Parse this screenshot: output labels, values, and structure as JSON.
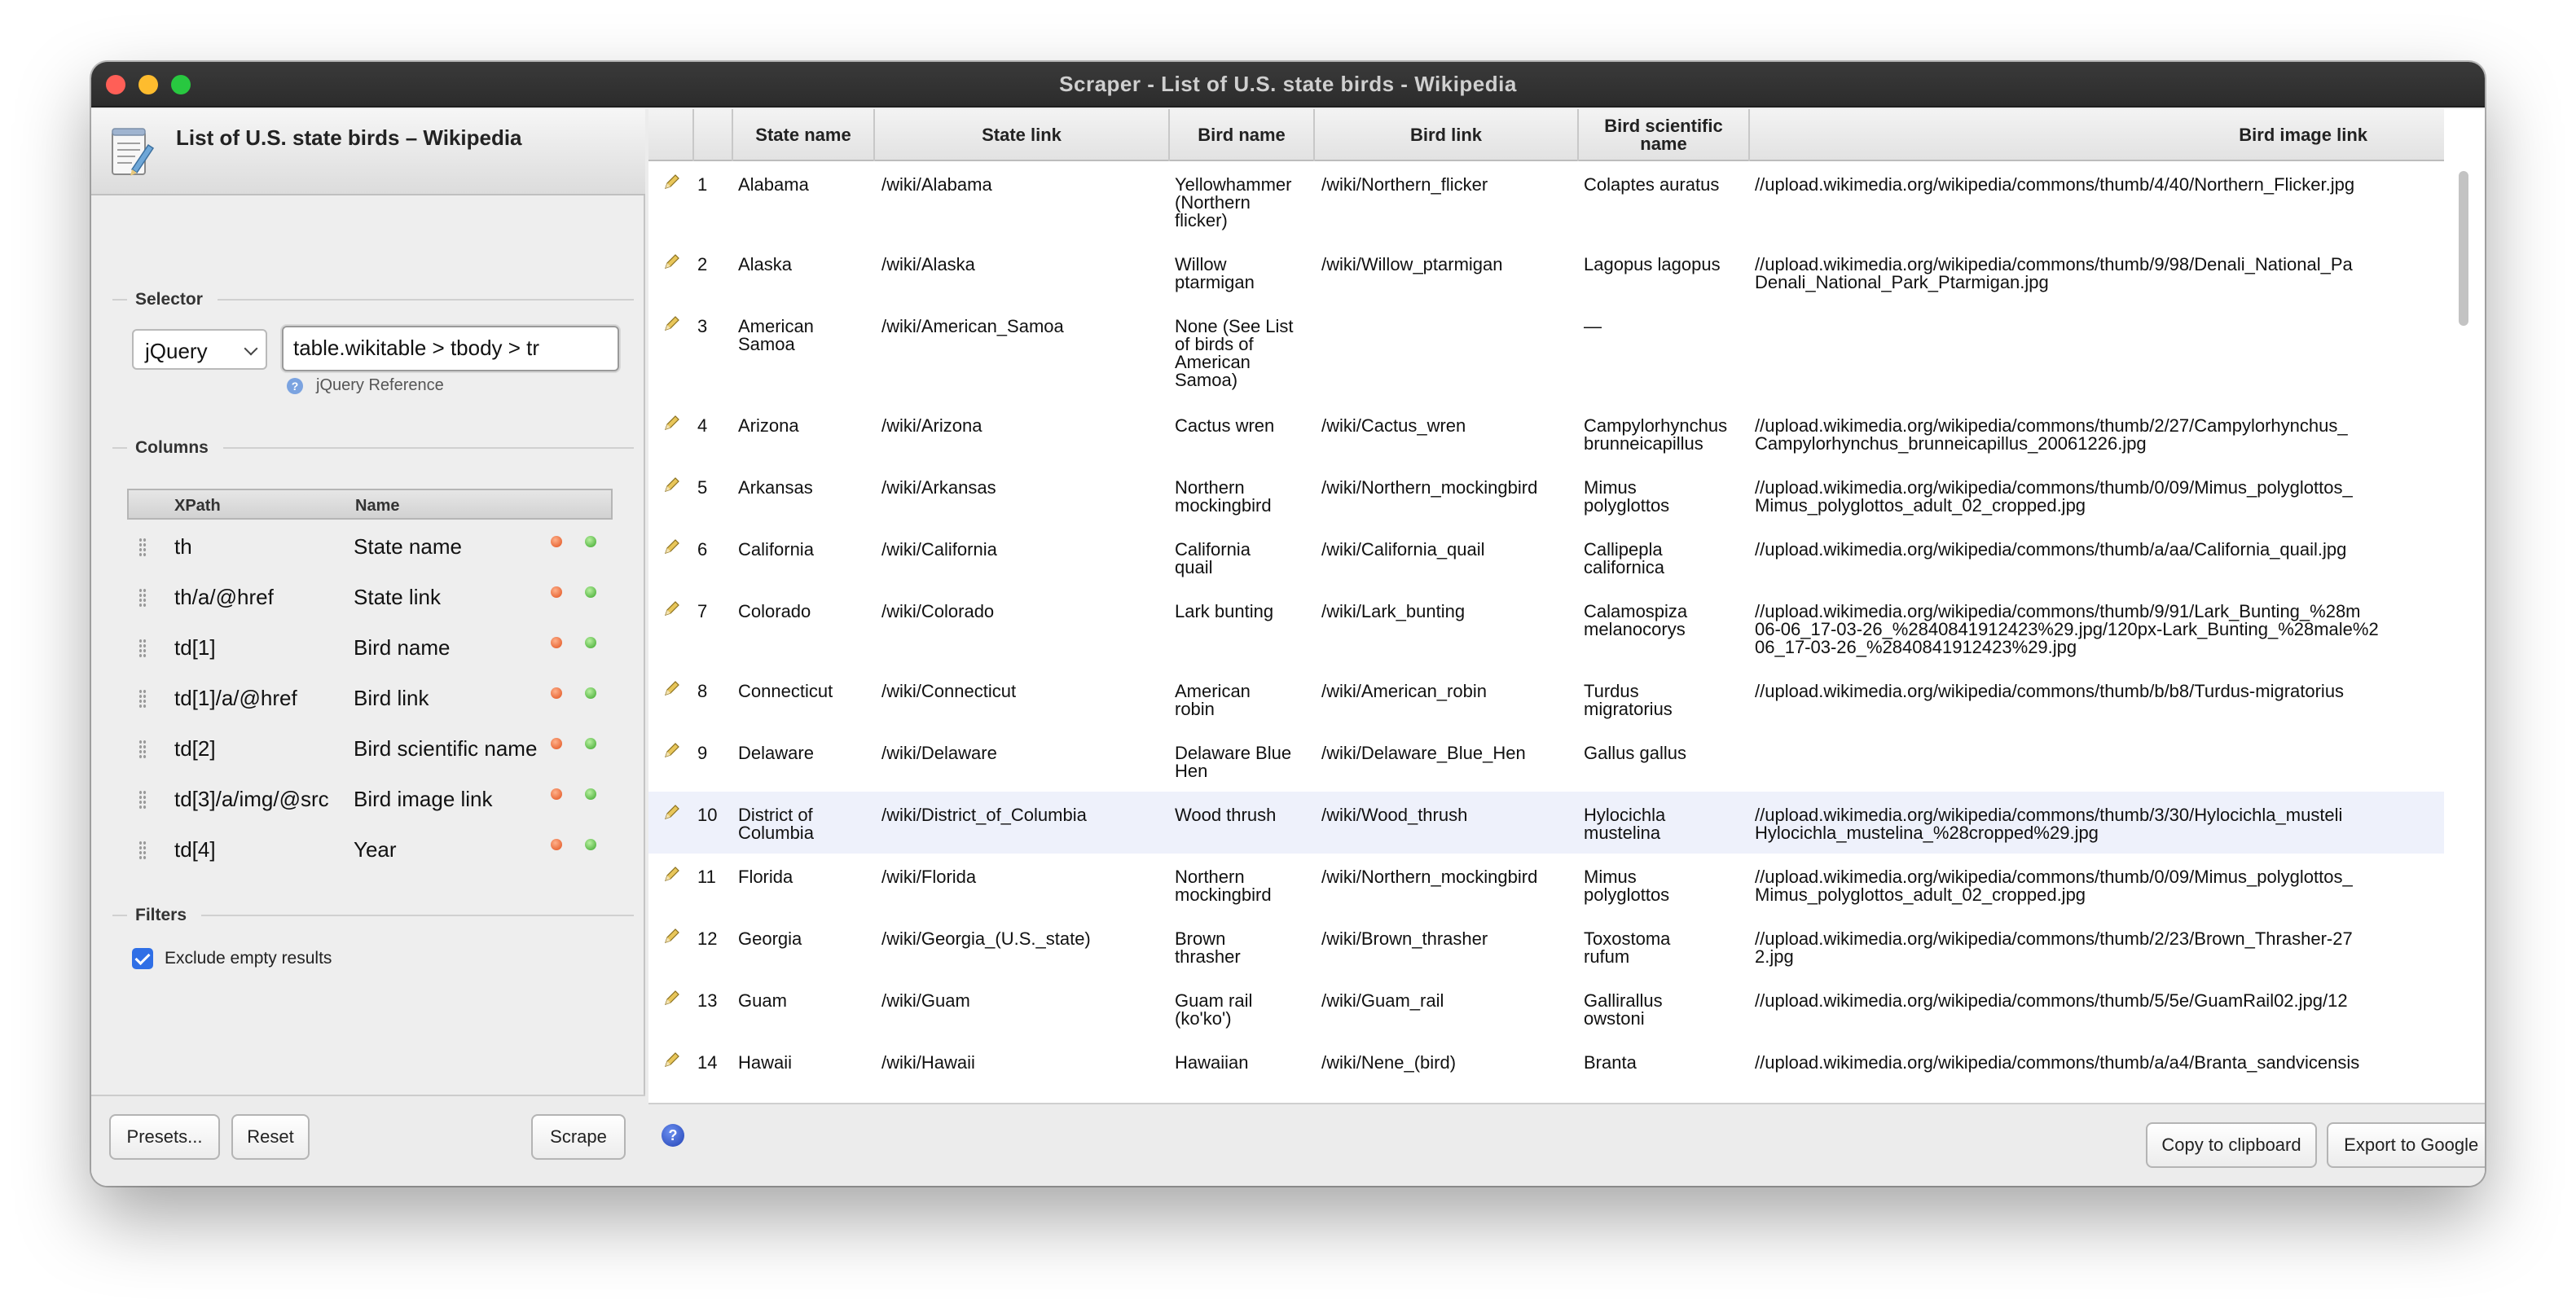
{
  "window": {
    "title": "Scraper - List of U.S. state birds - Wikipedia"
  },
  "document": {
    "title": "List of U.S. state birds – Wikipedia"
  },
  "selector": {
    "section_label": "Selector",
    "type": "jQuery",
    "value": "table.wikitable > tbody > tr",
    "reference_label": "jQuery Reference"
  },
  "columns": {
    "section_label": "Columns",
    "headers": {
      "xpath": "XPath",
      "name": "Name"
    },
    "items": [
      {
        "xpath": "th",
        "name": "State name"
      },
      {
        "xpath": "th/a/@href",
        "name": "State link"
      },
      {
        "xpath": "td[1]",
        "name": "Bird name"
      },
      {
        "xpath": "td[1]/a/@href",
        "name": "Bird link"
      },
      {
        "xpath": "td[2]",
        "name": "Bird scientific name"
      },
      {
        "xpath": "td[3]/a/img/@src",
        "name": "Bird image link"
      },
      {
        "xpath": "td[4]",
        "name": "Year"
      }
    ]
  },
  "filters": {
    "section_label": "Filters",
    "exclude_empty_label": "Exclude empty results"
  },
  "buttons": {
    "presets": "Presets...",
    "reset": "Reset",
    "scrape": "Scrape",
    "copy": "Copy to clipboard",
    "export": "Export to Google Docs..."
  },
  "results": {
    "headers": [
      "State name",
      "State link",
      "Bird name",
      "Bird link",
      "Bird scientific\nname",
      "Bird image link"
    ],
    "rows": [
      {
        "n": "1",
        "state": "Alabama",
        "link": "/wiki/Alabama",
        "bird": "Yellowhammer\n(Northern\nflicker)",
        "blink": "/wiki/Northern_flicker",
        "sci": "Colaptes auratus",
        "img": "//upload.wikimedia.org/wikipedia/commons/thumb/4/40/Northern_Flicker.jpg"
      },
      {
        "n": "2",
        "state": "Alaska",
        "link": "/wiki/Alaska",
        "bird": "Willow\nptarmigan",
        "blink": "/wiki/Willow_ptarmigan",
        "sci": "Lagopus lagopus",
        "img": "//upload.wikimedia.org/wikipedia/commons/thumb/9/98/Denali_National_Pa\nDenali_National_Park_Ptarmigan.jpg"
      },
      {
        "n": "3",
        "state": "American\nSamoa",
        "link": "/wiki/American_Samoa",
        "bird": "None (See List\nof birds of\nAmerican\nSamoa)",
        "blink": "",
        "sci": "—",
        "img": ""
      },
      {
        "n": "4",
        "state": "Arizona",
        "link": "/wiki/Arizona",
        "bird": "Cactus wren",
        "blink": "/wiki/Cactus_wren",
        "sci": "Campylorhynchus\nbrunneicapillus",
        "img": "//upload.wikimedia.org/wikipedia/commons/thumb/2/27/Campylorhynchus_\nCampylorhynchus_brunneicapillus_20061226.jpg"
      },
      {
        "n": "5",
        "state": "Arkansas",
        "link": "/wiki/Arkansas",
        "bird": "Northern\nmockingbird",
        "blink": "/wiki/Northern_mockingbird",
        "sci": "Mimus\npolyglottos",
        "img": "//upload.wikimedia.org/wikipedia/commons/thumb/0/09/Mimus_polyglottos_\nMimus_polyglottos_adult_02_cropped.jpg"
      },
      {
        "n": "6",
        "state": "California",
        "link": "/wiki/California",
        "bird": "California\nquail",
        "blink": "/wiki/California_quail",
        "sci": "Callipepla\ncalifornica",
        "img": "//upload.wikimedia.org/wikipedia/commons/thumb/a/aa/California_quail.jpg"
      },
      {
        "n": "7",
        "state": "Colorado",
        "link": "/wiki/Colorado",
        "bird": "Lark bunting",
        "blink": "/wiki/Lark_bunting",
        "sci": "Calamospiza\nmelanocorys",
        "img": "//upload.wikimedia.org/wikipedia/commons/thumb/9/91/Lark_Bunting_%28m\n06-06_17-03-26_%2840841912423%29.jpg/120px-Lark_Bunting_%28male%2\n06_17-03-26_%2840841912423%29.jpg"
      },
      {
        "n": "8",
        "state": "Connecticut",
        "link": "/wiki/Connecticut",
        "bird": "American\nrobin",
        "blink": "/wiki/American_robin",
        "sci": "Turdus\nmigratorius",
        "img": "//upload.wikimedia.org/wikipedia/commons/thumb/b/b8/Turdus-migratorius"
      },
      {
        "n": "9",
        "state": "Delaware",
        "link": "/wiki/Delaware",
        "bird": "Delaware Blue\nHen",
        "blink": "/wiki/Delaware_Blue_Hen",
        "sci": "Gallus gallus",
        "img": ""
      },
      {
        "n": "10",
        "state": "District of\nColumbia",
        "link": "/wiki/District_of_Columbia",
        "bird": "Wood thrush",
        "blink": "/wiki/Wood_thrush",
        "sci": "Hylocichla\nmustelina",
        "img": "//upload.wikimedia.org/wikipedia/commons/thumb/3/30/Hylocichla_musteli\nHylocichla_mustelina_%28cropped%29.jpg"
      },
      {
        "n": "11",
        "state": "Florida",
        "link": "/wiki/Florida",
        "bird": "Northern\nmockingbird",
        "blink": "/wiki/Northern_mockingbird",
        "sci": "Mimus\npolyglottos",
        "img": "//upload.wikimedia.org/wikipedia/commons/thumb/0/09/Mimus_polyglottos_\nMimus_polyglottos_adult_02_cropped.jpg"
      },
      {
        "n": "12",
        "state": "Georgia",
        "link": "/wiki/Georgia_(U.S._state)",
        "bird": "Brown\nthrasher",
        "blink": "/wiki/Brown_thrasher",
        "sci": "Toxostoma\nrufum",
        "img": "//upload.wikimedia.org/wikipedia/commons/thumb/2/23/Brown_Thrasher-27\n2.jpg"
      },
      {
        "n": "13",
        "state": "Guam",
        "link": "/wiki/Guam",
        "bird": "Guam rail\n(ko'ko')",
        "blink": "/wiki/Guam_rail",
        "sci": "Gallirallus\nowstoni",
        "img": "//upload.wikimedia.org/wikipedia/commons/thumb/5/5e/GuamRail02.jpg/12"
      },
      {
        "n": "14",
        "state": "Hawaii",
        "link": "/wiki/Hawaii",
        "bird": "Hawaiian",
        "blink": "/wiki/Nene_(bird)",
        "sci": "Branta",
        "img": "//upload.wikimedia.org/wikipedia/commons/thumb/a/a4/Branta_sandvicensis"
      }
    ]
  },
  "colors": {
    "accent": "#2f6fe6",
    "highlight_row": "#eef1fb",
    "titlebar": "#2c2c2c"
  },
  "icons": [
    "document-icon",
    "help-icon",
    "pencil-icon",
    "remove-icon",
    "add-icon",
    "drag-handle-icon"
  ]
}
